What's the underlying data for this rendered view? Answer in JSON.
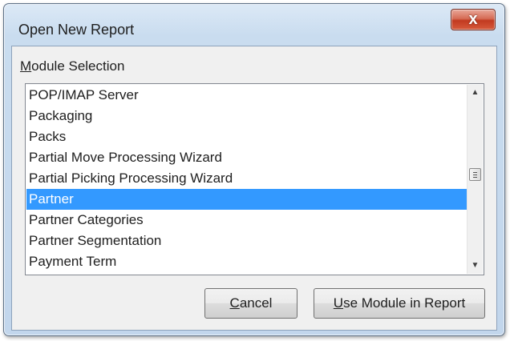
{
  "dialog": {
    "title": "Open New Report",
    "close_label": "x"
  },
  "module_selection": {
    "label_mnemonic": "M",
    "label_rest": "odule Selection",
    "items": [
      {
        "label": "POP/IMAP Server",
        "selected": false
      },
      {
        "label": "Packaging",
        "selected": false
      },
      {
        "label": "Packs",
        "selected": false
      },
      {
        "label": "Partial Move Processing Wizard",
        "selected": false
      },
      {
        "label": "Partial Picking Processing Wizard",
        "selected": false
      },
      {
        "label": "Partner",
        "selected": true
      },
      {
        "label": "Partner Categories",
        "selected": false
      },
      {
        "label": "Partner Segmentation",
        "selected": false
      },
      {
        "label": "Payment Term",
        "selected": false
      }
    ],
    "scroll_up_glyph": "▲",
    "scroll_down_glyph": "▼"
  },
  "buttons": {
    "cancel_mnemonic": "C",
    "cancel_rest": "ancel",
    "use_mnemonic": "U",
    "use_rest": "se Module in Report"
  },
  "colors": {
    "selection": "#3399ff",
    "close_button": "#c23a20"
  }
}
